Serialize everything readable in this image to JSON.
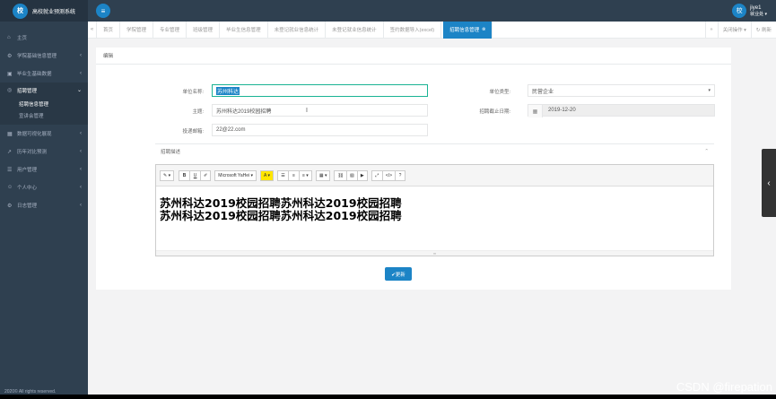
{
  "app": {
    "logo_glyph": "校",
    "title": "高校就业预测系统"
  },
  "topbar": {
    "menu_icon": "≡",
    "avatar_glyph": "校",
    "user_name": "jiye1",
    "user_role": "就业处 ▾"
  },
  "sidebar": {
    "items": [
      {
        "icon": "⌂",
        "label": "主页",
        "arrow": ""
      },
      {
        "icon": "⚙",
        "label": "学院基础信息管理",
        "arrow": "‹"
      },
      {
        "icon": "▣",
        "label": "毕业生基础数据",
        "arrow": "‹"
      },
      {
        "icon": "◎",
        "label": "招聘管理",
        "arrow": "⌄"
      }
    ],
    "sub_items": [
      {
        "label": "招聘信息管理"
      },
      {
        "label": "宣讲会管理"
      }
    ],
    "items_after": [
      {
        "icon": "▦",
        "label": "数据可视化展现",
        "arrow": "‹"
      },
      {
        "icon": "↗",
        "label": "历年对比预测",
        "arrow": "‹"
      },
      {
        "icon": "☰",
        "label": "用户管理",
        "arrow": "‹"
      },
      {
        "icon": "☺",
        "label": "个人中心",
        "arrow": "‹"
      },
      {
        "icon": "⚙",
        "label": "日志管理",
        "arrow": "‹"
      }
    ],
    "copyright": "2020© All rights reserved."
  },
  "tabs": {
    "left_nav": "«",
    "items": [
      "首页",
      "学院管理",
      "专业管理",
      "班级管理",
      "毕业生信息管理",
      "未登记就业信息统计",
      "未登记就业信息统计",
      "签约数据导入(excel)"
    ],
    "active": "招聘信息管理",
    "active_close": "⊗",
    "right_nav": "»",
    "close_ops": "关闭操作 ▾",
    "refresh": "↻ 刷新"
  },
  "panel": {
    "title": "编辑"
  },
  "form": {
    "company_label": "单位名称:",
    "company_value": "苏州科达",
    "type_label": "单位类型:",
    "type_value": "民营企业",
    "subject_label": "主题:",
    "subject_value": "苏州科达2019校园招聘",
    "deadline_label": "招聘截止日期:",
    "deadline_value": "2019-12-20",
    "email_label": "投递邮箱:",
    "email_value": "22@22.com"
  },
  "description": {
    "title": "招聘描述",
    "toggle": "⌃",
    "toolbar": {
      "pen": "✎ ▾",
      "bold": "B",
      "underline": "U",
      "eraser": "✐",
      "font": "Microsoft YaHei ▾",
      "color": "A ▾",
      "ul": "☰",
      "ol": "≡",
      "align": "≡ ▾",
      "table": "▦ ▾",
      "link": "⛓",
      "image": "▧",
      "video": "▶",
      "fullscreen": "⤢",
      "code": "</>",
      "help": "?"
    },
    "content_lines": [
      "苏州科达2019校园招聘苏州科达2019校园招聘",
      "苏州科达2019校园招聘苏州科达2019校园招聘"
    ],
    "resize": "═"
  },
  "save_button": "✔更新",
  "side_handle": "‹",
  "watermark": "CSDN @firepation",
  "colors": {
    "sidebar": "#2f4050",
    "accent": "#1c84c6",
    "focus": "#1ab394"
  }
}
